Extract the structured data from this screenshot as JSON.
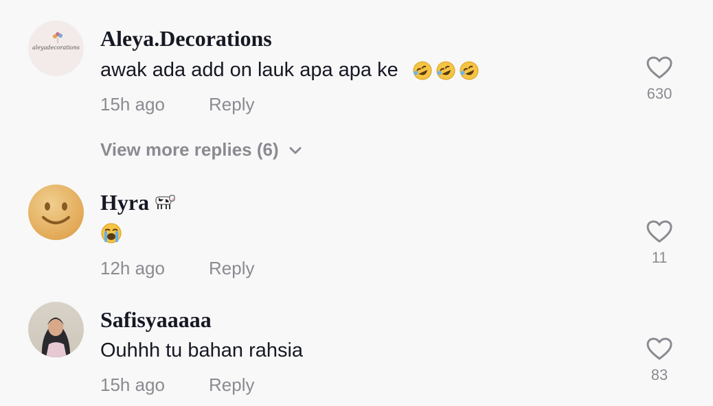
{
  "comments": [
    {
      "username": "Aleya.Decorations",
      "avatar_text": "aleyadecorations",
      "text": "awak ada add on lauk apa apa ke",
      "emoji": [
        "rolling-on-floor-laughing",
        "rolling-on-floor-laughing",
        "rolling-on-floor-laughing"
      ],
      "time": "15h ago",
      "reply_label": "Reply",
      "likes": "630"
    },
    {
      "username": "Hyra",
      "username_emoji": "cow",
      "text": "",
      "emoji": [
        "loudly-crying-face"
      ],
      "time": "12h ago",
      "reply_label": "Reply",
      "likes": "11"
    },
    {
      "username": "Safisyaaaaa",
      "text": "Ouhhh tu bahan rahsia",
      "time": "15h ago",
      "reply_label": "Reply",
      "likes": "83"
    }
  ],
  "view_more": {
    "label": "View more replies (6)"
  },
  "colors": {
    "background": "#f8f8f8",
    "text": "#161823",
    "muted": "#8a8b91"
  }
}
